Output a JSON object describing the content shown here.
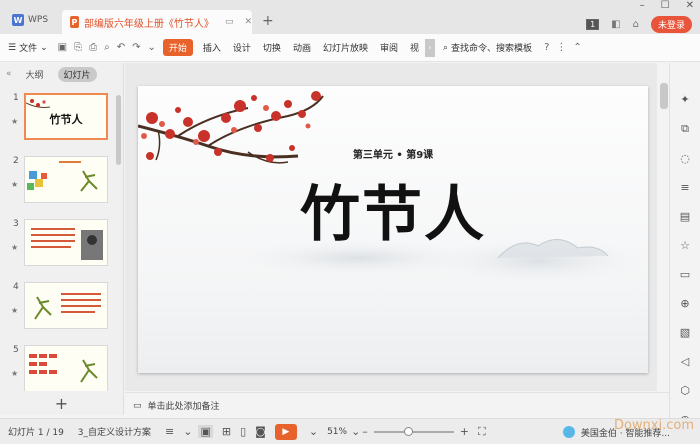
{
  "titlebar": {
    "app_name": "WPS",
    "doc_title": "部编版六年级上册《竹节人》",
    "login_label": "未登录",
    "badge": "1"
  },
  "ribbon": {
    "file_label": "文件",
    "tabs": [
      "开始",
      "插入",
      "设计",
      "切换",
      "动画",
      "幻灯片放映",
      "审阅",
      "视"
    ],
    "search_label": "查找命令、搜索模板"
  },
  "leftpanel": {
    "tabs": [
      "大纲",
      "幻灯片"
    ],
    "slides": [
      {
        "num": "1",
        "label": "竹节人"
      },
      {
        "num": "2",
        "label": ""
      },
      {
        "num": "3",
        "label": ""
      },
      {
        "num": "4",
        "label": ""
      },
      {
        "num": "5",
        "label": ""
      }
    ]
  },
  "slide": {
    "subtitle": "第三单元 • 第9课",
    "title": "竹节人"
  },
  "notes": {
    "placeholder": "单击此处添加备注"
  },
  "status": {
    "slide_counter": "幻灯片 1 / 19",
    "theme": "3_自定义设计方案",
    "zoom": "51%",
    "right_text": "美国金伯 · 智能推荐...",
    "watermark": "Downxi.com"
  },
  "colors": {
    "accent": "#e8632b",
    "login": "#e8553a"
  }
}
